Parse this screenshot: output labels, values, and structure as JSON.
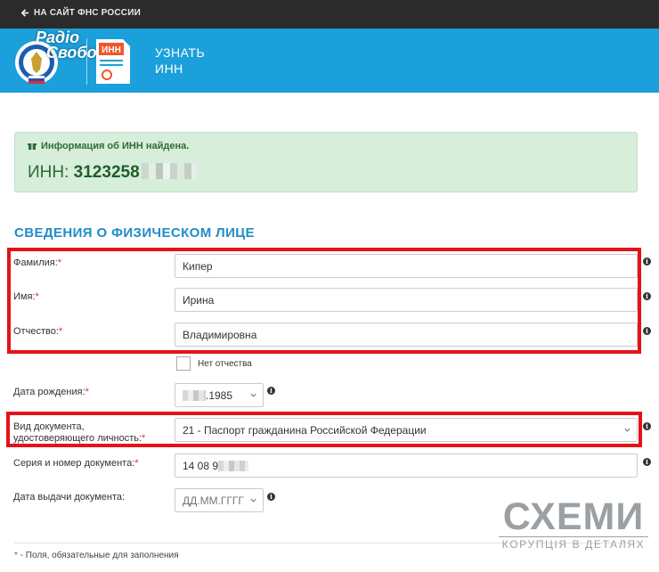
{
  "topbar": {
    "back_label": "НА САЙТ ФНС РОССИИ"
  },
  "header": {
    "title_line1": "УЗНАТЬ",
    "title_line2": "ИНН",
    "inn_icon_text": "ИНН",
    "watermark_line1": "Радіо",
    "watermark_line2": "Свобода"
  },
  "alert": {
    "message": "Информация об ИНН найдена.",
    "inn_label": "ИНН:",
    "inn_value_visible": "3123258"
  },
  "section": {
    "title": "СВЕДЕНИЯ О ФИЗИЧЕСКОМ ЛИЦЕ"
  },
  "form": {
    "required_mark": "*",
    "surname": {
      "label": "Фамилия:",
      "value": "Кипер"
    },
    "name": {
      "label": "Имя:",
      "value": "Ирина"
    },
    "patronymic": {
      "label": "Отчество:",
      "value": "Владимировна"
    },
    "no_patronymic": {
      "label": "Нет отчества",
      "checked": false
    },
    "birth_date": {
      "label": "Дата рождения:",
      "value_visible": ".1985"
    },
    "doc_type": {
      "label_line1": "Вид документа,",
      "label_line2": "удостоверяющего личность:",
      "value": "21 - Паспорт гражданина Российской Федерации"
    },
    "doc_number": {
      "label": "Серия и номер документа:",
      "value_visible": "14 08 9"
    },
    "issue_date": {
      "label": "Дата выдачи документа:",
      "placeholder": "ДД.ММ.ГГГГ"
    }
  },
  "footnote": {
    "text": "- Поля, обязательные для заполнения"
  },
  "watermark": {
    "brand": "СХЕМИ",
    "tagline": "КОРУПЦІЯ В ДЕТАЛЯХ"
  },
  "colors": {
    "topbar": "#2b2b2b",
    "header_band": "#1ba0db",
    "alert_bg": "#d7eedb",
    "section_title": "#1f8dc9",
    "highlight_frame": "#e2131b",
    "required": "#d9342b"
  },
  "icons": [
    "arrow-left-icon",
    "gift-icon",
    "info-icon",
    "chevron-down-icon",
    "fns-emblem-icon",
    "inn-document-icon"
  ]
}
